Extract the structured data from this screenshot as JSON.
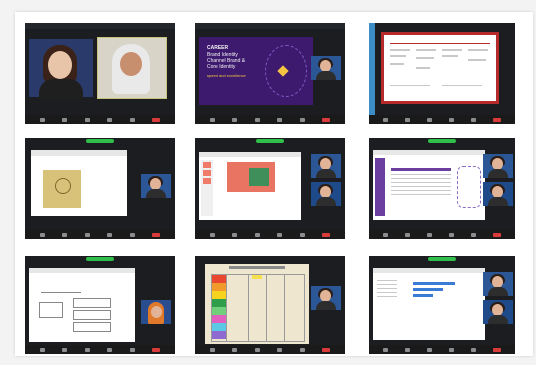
{
  "slides": {
    "title_line1": "CAREER",
    "title_line2": "Brand Identity",
    "title_line3": "Channel Brand &",
    "title_line4": "Core Identity",
    "subtitle": "speed and excellence"
  },
  "colors": {
    "frame_bg": "#f3f3f3",
    "tile_bg": "#1b1d21",
    "accent_blue": "#3c8cc6",
    "zoom_green": "#2fbf4a",
    "end_red": "#d93b3b",
    "slide_purple": "#3d1a6e"
  }
}
